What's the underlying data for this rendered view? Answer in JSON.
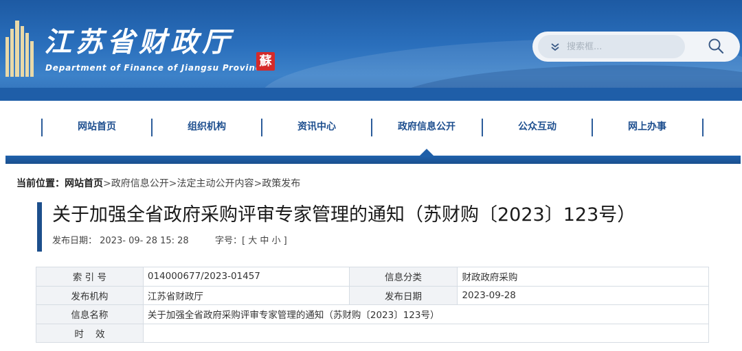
{
  "header": {
    "logo_cn": "江苏省财政厅",
    "logo_en": "Department of Finance of Jiangsu Province",
    "seal_char": "蘇",
    "brand_color": "#1d5aa3",
    "search": {
      "placeholder": "搜索框...",
      "dropdown_icon": "chevron-down-icon",
      "submit_icon": "search-icon"
    }
  },
  "nav": {
    "items": [
      "网站首页",
      "组织机构",
      "资讯中心",
      "政府信息公开",
      "公众互动",
      "网上办事"
    ],
    "active": "政府信息公开"
  },
  "breadcrumb": {
    "label": "当前位置：",
    "home": "网站首页",
    "sep": ">",
    "items": [
      "政府信息公开",
      "法定主动公开内容",
      "政策发布"
    ]
  },
  "article": {
    "title": "关于加强全省政府采购评审专家管理的通知（苏财购〔2023〕123号）",
    "date_label": "发布日期：",
    "date": "2023- 09- 28   15: 28",
    "fontsize_label": "字号：[",
    "fontsize_options": [
      "大",
      "中",
      "小"
    ],
    "fontsize_end": "]"
  },
  "info_table": {
    "rows": [
      {
        "k1": "索 引 号",
        "v1": "014000677/2023-01457",
        "k2": "信息分类",
        "v2": "财政政府采购"
      },
      {
        "k1": "发布机构",
        "v1": "江苏省财政厅",
        "k2": "发布日期",
        "v2": "2023-09-28"
      },
      {
        "k1": "信息名称",
        "full": "关于加强全省政府采购评审专家管理的通知（苏财购〔2023〕123号）"
      },
      {
        "k1": "时    效",
        "full": ""
      }
    ]
  }
}
